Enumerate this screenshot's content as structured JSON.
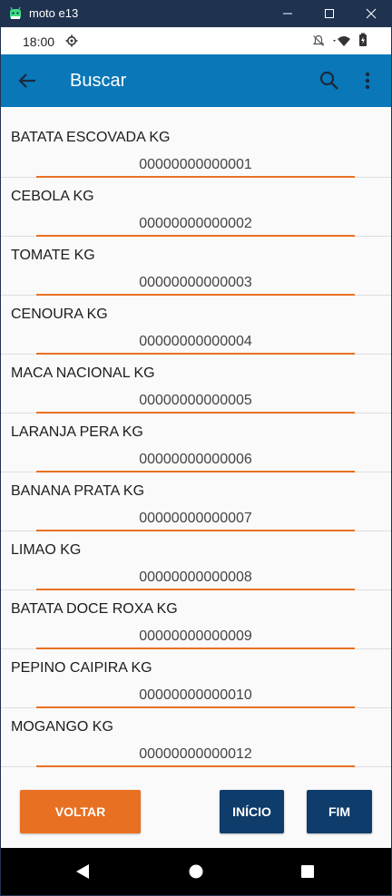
{
  "window": {
    "title": "moto e13"
  },
  "status_bar": {
    "time": "18:00"
  },
  "app_bar": {
    "title": "Buscar"
  },
  "items": [
    {
      "name": "BATATA ESCOVADA KG",
      "code": "00000000000001"
    },
    {
      "name": "CEBOLA KG",
      "code": "00000000000002"
    },
    {
      "name": "TOMATE KG",
      "code": "00000000000003"
    },
    {
      "name": "CENOURA KG",
      "code": "00000000000004"
    },
    {
      "name": "MACA NACIONAL KG",
      "code": "00000000000005"
    },
    {
      "name": "LARANJA PERA KG",
      "code": "00000000000006"
    },
    {
      "name": "BANANA PRATA KG",
      "code": "00000000000007"
    },
    {
      "name": "LIMAO KG",
      "code": "00000000000008"
    },
    {
      "name": "BATATA DOCE ROXA KG",
      "code": "00000000000009"
    },
    {
      "name": "PEPINO CAIPIRA KG",
      "code": "00000000000010"
    },
    {
      "name": "MOGANGO KG",
      "code": "00000000000012"
    }
  ],
  "buttons": {
    "voltar": "VOLTAR",
    "inicio": "INÍCIO",
    "fim": "FIM"
  },
  "colors": {
    "app_bar": "#0a77b8",
    "accent_orange": "#e87022",
    "dark_button": "#0e3c6b",
    "window_chrome": "#1f3350"
  },
  "icons": {
    "app": "android-icon",
    "minimize": "minimize-icon",
    "maximize": "maximize-icon",
    "close": "close-icon",
    "settings": "settings-gear-icon",
    "dnd": "notifications-off-icon",
    "wifi": "wifi-icon",
    "battery": "battery-icon",
    "back": "arrow-back-icon",
    "search": "search-icon",
    "more": "more-vert-icon",
    "nav_back": "nav-back-icon",
    "nav_home": "nav-home-icon",
    "nav_recents": "nav-recents-icon"
  }
}
